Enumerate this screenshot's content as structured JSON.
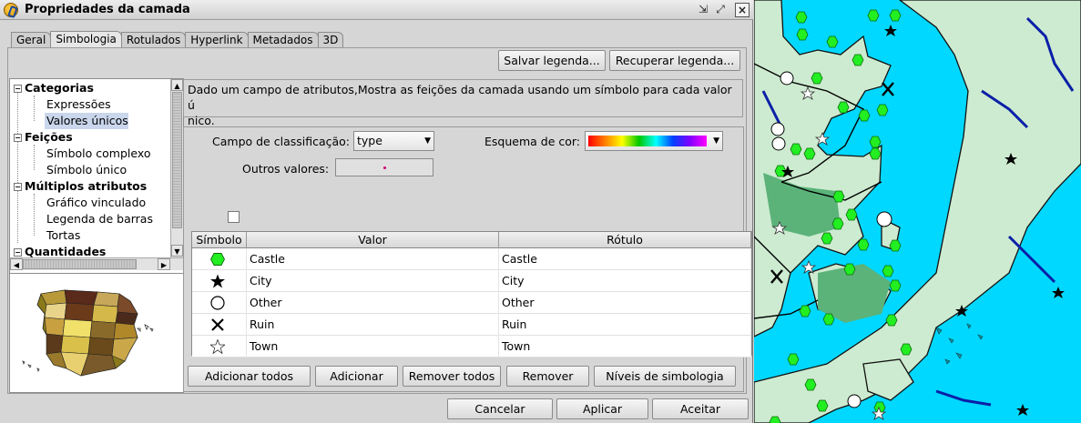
{
  "window": {
    "title": "Propriedades da camada"
  },
  "tabs": [
    "Geral",
    "Simbologia",
    "Rotulados",
    "Hyperlink",
    "Metadados",
    "3D"
  ],
  "top_buttons": {
    "save_legend": "Salvar legenda...",
    "load_legend": "Recuperar legenda..."
  },
  "tree": {
    "categories": [
      {
        "label": "Categorias",
        "items": [
          "Expressões",
          "Valores únicos"
        ]
      },
      {
        "label": "Feições",
        "items": [
          "Símbolo complexo",
          "Símbolo único"
        ]
      },
      {
        "label": "Múltiplos atributos",
        "items": [
          "Gráfico vinculado",
          "Legenda de barras",
          "Tortas"
        ]
      },
      {
        "label": "Quantidades",
        "items": []
      }
    ],
    "selected": "Valores únicos"
  },
  "description": "Dado um campo de atributos,Mostra as feições da camada usando um símbolo para cada valor único.",
  "description_lines": [
    "Dado um campo de atributos,Mostra as feições da camada usando um símbolo para cada valor ú",
    "nico."
  ],
  "classification": {
    "label": "Campo de classificação:",
    "value": "type"
  },
  "color_scheme": {
    "label": "Esquema de cor:"
  },
  "other_values": {
    "label": "Outros valores:",
    "checked": false
  },
  "table": {
    "headers": [
      "Símbolo",
      "Valor",
      "Rótulo"
    ],
    "rows": [
      {
        "symbol": "green-hexagon-icon",
        "value": "Castle",
        "label": "Castle"
      },
      {
        "symbol": "black-star-icon",
        "value": "City",
        "label": "City"
      },
      {
        "symbol": "white-circle-icon",
        "value": "Other",
        "label": "Other"
      },
      {
        "symbol": "black-x-icon",
        "value": "Ruin",
        "label": "Ruin"
      },
      {
        "symbol": "white-star-icon",
        "value": "Town",
        "label": "Town"
      }
    ]
  },
  "table_buttons": {
    "add_all": "Adicionar todos",
    "add": "Adicionar",
    "remove_all": "Remover todos",
    "remove": "Remover",
    "levels": "Níveis de simbologia"
  },
  "dialog_buttons": {
    "cancel": "Cancelar",
    "apply": "Aplicar",
    "accept": "Aceitar"
  },
  "colors": {
    "water": "#00d8ff",
    "land": "#cdebd0",
    "dark_land": "#5bb37a",
    "castle": "#22ee22",
    "river": "#0b1fa8"
  }
}
